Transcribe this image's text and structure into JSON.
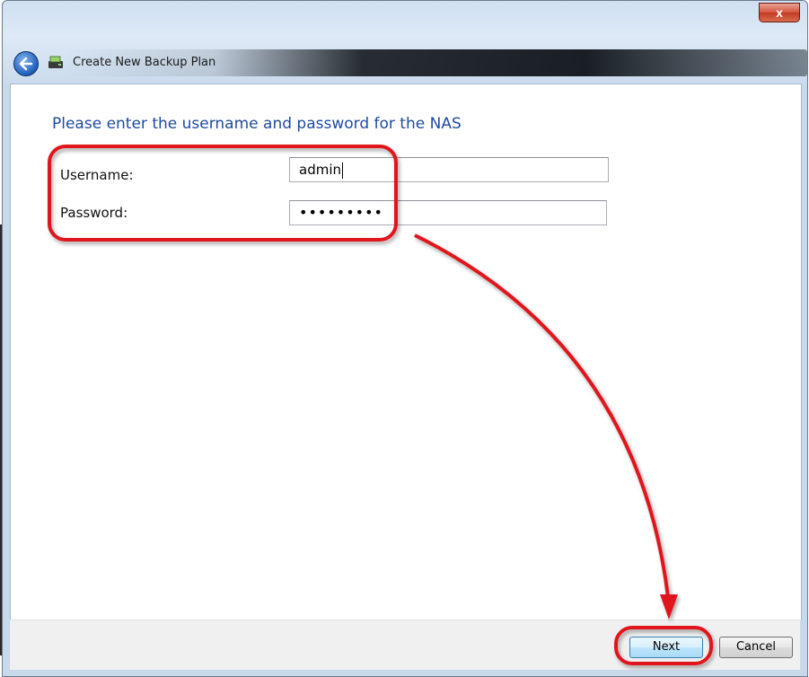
{
  "window": {
    "title": "Create New Backup Plan",
    "close_glyph": "x",
    "back_icon": "back-arrow-icon",
    "app_icon": "backup-drive-icon"
  },
  "page": {
    "heading": "Please enter the username and password for the NAS"
  },
  "form": {
    "username_label": "Username:",
    "username_value": "admin",
    "password_label": "Password:",
    "password_value": "•••••••••"
  },
  "footer": {
    "next_label": "Next",
    "cancel_label": "Cancel"
  },
  "colors": {
    "heading": "#1e4a9e",
    "annotation": "#e0141b"
  }
}
